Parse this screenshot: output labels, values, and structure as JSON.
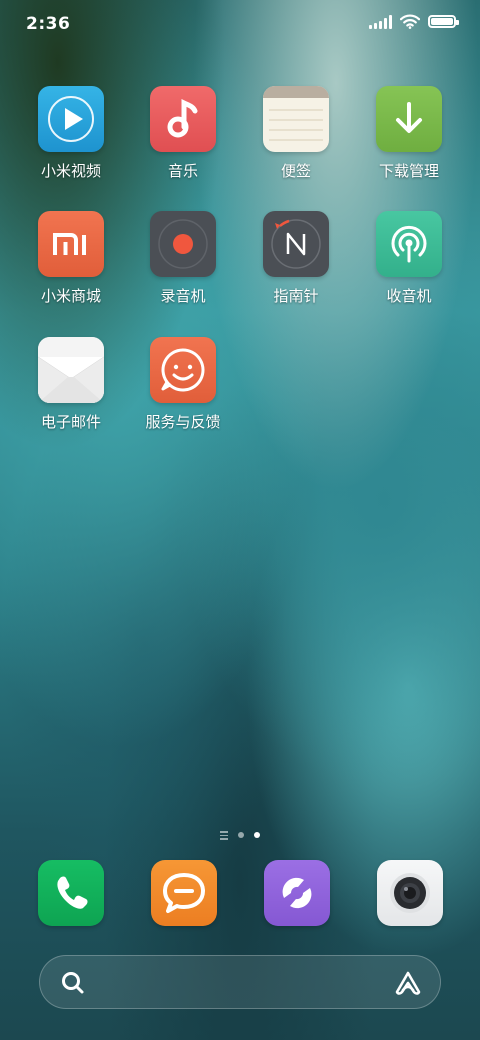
{
  "status_bar": {
    "time": "2:36",
    "battery_level": 1.0
  },
  "apps": [
    {
      "label": "小米视频",
      "icon": "mi-video-icon"
    },
    {
      "label": "音乐",
      "icon": "music-icon"
    },
    {
      "label": "便签",
      "icon": "notes-icon"
    },
    {
      "label": "下载管理",
      "icon": "download-icon"
    },
    {
      "label": "小米商城",
      "icon": "mi-store-icon"
    },
    {
      "label": "录音机",
      "icon": "recorder-icon"
    },
    {
      "label": "指南针",
      "icon": "compass-icon"
    },
    {
      "label": "收音机",
      "icon": "radio-icon"
    },
    {
      "label": "电子邮件",
      "icon": "email-icon"
    },
    {
      "label": "服务与反馈",
      "icon": "service-feedback-icon"
    }
  ],
  "dock": [
    {
      "icon": "phone-icon"
    },
    {
      "icon": "messages-icon"
    },
    {
      "icon": "browser-icon"
    },
    {
      "icon": "camera-icon"
    }
  ],
  "page_indicator": {
    "pages": 2,
    "current": 2
  },
  "colors": {
    "video": "#2aa3da",
    "music": "#e85b5b",
    "download": "#7cb84a",
    "store": "#ea6a42",
    "recorder": "#4a4d52",
    "compass": "#4a4d52",
    "radio": "#3dbe98",
    "service": "#ea6a42",
    "phone": "#12b35a",
    "messages": "#f08a2c",
    "browser": "#8e63d9",
    "camera": "#eef0f1"
  }
}
